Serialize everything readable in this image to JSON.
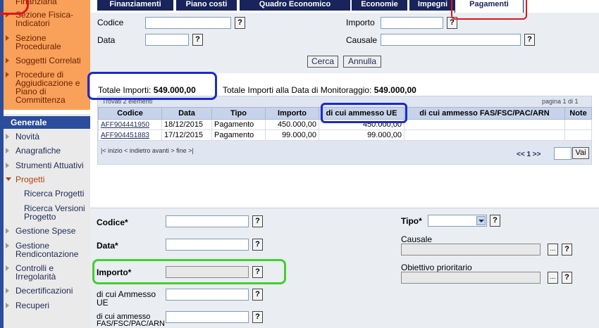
{
  "sidebar": {
    "top_items": [
      "Finanziaria",
      "Sezione Fisica-Indicatori",
      "Sezione Procedurale",
      "Soggetti Correlati",
      "Procedure di Aggiudicazione e Piano di Committenza"
    ],
    "section_title": "Generale",
    "items": [
      "Novità",
      "Anagrafiche",
      "Strumenti Attuativi",
      "Progetti",
      "Gestione Spese",
      "Gestione Rendicontazione",
      "Controlli e Irregolarità",
      "Decertificazioni",
      "Recuperi"
    ],
    "sub_items": [
      "Ricerca Progetti",
      "Ricerca Versioni Progetto"
    ]
  },
  "tabs": [
    "Finanziamenti",
    "Piano costi",
    "Quadro Economico",
    "Economie",
    "Impegni",
    "Pagamenti"
  ],
  "search": {
    "codice_label": "Codice",
    "data_label": "Data",
    "importo_label": "Importo",
    "causale_label": "Causale",
    "help": "?",
    "search_button": "Cerca",
    "cancel_button": "Annulla"
  },
  "totals": {
    "label1": "Totale Importi:",
    "value1": "549.000,00",
    "label2": "Totale Importi alla Data di Monitoraggio:",
    "value2": "549.000,00"
  },
  "results": {
    "found": "Trovati 2 elementi",
    "page": "pagina 1 di 1",
    "columns": [
      "Codice",
      "Data",
      "Tipo",
      "Importo",
      "di cui ammesso UE",
      "di cui ammesso FAS/FSC/PAC/ARN",
      "Note"
    ],
    "rows": [
      [
        "AFF904441950",
        "18/12/2015",
        "Pagamento",
        "450.000,00",
        "450.000,00",
        "",
        ""
      ],
      [
        "AFF904451883",
        "17/12/2015",
        "Pagamento",
        "99.000,00",
        "99.000,00",
        "",
        ""
      ]
    ],
    "pager_nav": "|< inizio < indietro avanti > fine >|",
    "pager_pages": "<< 1 >>",
    "go_button": "Vai"
  },
  "form": {
    "codice_label": "Codice*",
    "data_label": "Data*",
    "importo_label": "Importo*",
    "ue_label": "di cui Ammesso UE",
    "fas_label": "di cui ammesso FAS/FSC/PAC/ARN",
    "tipo_label": "Tipo*",
    "causale_label": "Causale",
    "obiettivo_label": "Obiettivo prioritario",
    "ellipsis": "..."
  },
  "colors": {
    "nav_dark": "#18245a",
    "sidebar_orange": "#f9a15a",
    "highlight_red": "#e0141c",
    "highlight_blue": "#1b2bc9",
    "highlight_green": "#3fd12b"
  }
}
